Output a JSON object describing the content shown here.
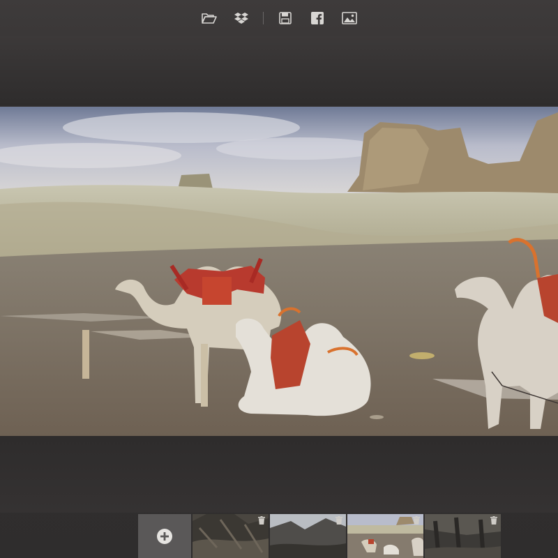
{
  "toolbar": {
    "buttons": [
      {
        "icon": "folder-open-icon"
      },
      {
        "icon": "dropbox-icon"
      },
      {
        "icon": "save-icon"
      },
      {
        "icon": "facebook-icon"
      },
      {
        "icon": "image-icon"
      }
    ]
  },
  "photo": {
    "subject": "camels",
    "active_thumbnail_index": 2
  },
  "filmstrip": {
    "add_button_icon": "add-circle-icon",
    "thumbnails": [
      {
        "icon": "trash-icon"
      },
      {
        "icon": "trash-icon"
      },
      {
        "icon": "trash-icon",
        "active": true
      },
      {
        "icon": "trash-icon"
      }
    ]
  },
  "colors": {
    "background": "#353232",
    "toolbar_icon": "#d8d6d3",
    "add_tile": "#5a5858"
  }
}
